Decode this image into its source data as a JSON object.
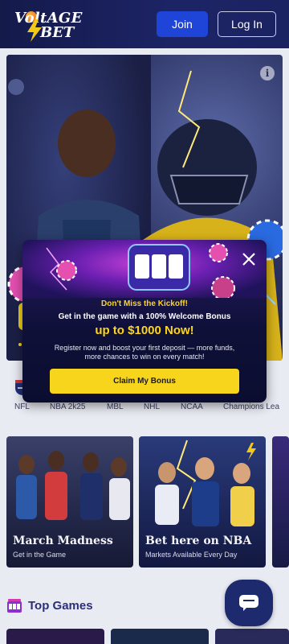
{
  "header": {
    "logo_line1": "VoltAGE",
    "logo_line2": "BET",
    "join_label": "Join",
    "login_label": "Log In"
  },
  "hero": {
    "info_icon": "info-icon"
  },
  "sports": [
    {
      "label": "NFL",
      "icon": "nfl-shield-icon"
    },
    {
      "label": "NBA 2k25"
    },
    {
      "label": "MBL"
    },
    {
      "label": "NHL"
    },
    {
      "label": "NCAA"
    },
    {
      "label": "Champions Lea"
    }
  ],
  "promos": [
    {
      "title": "March Madness",
      "subtitle": "Get in the Game"
    },
    {
      "title": "Bet here on NBA",
      "subtitle": "Markets Available Every Day"
    }
  ],
  "top_games": {
    "title": "Top Games",
    "icon": "slot-machine-icon"
  },
  "chat": {
    "icon": "chat-bubble-icon"
  },
  "modal": {
    "kicker": "Don't Miss the Kickoff!",
    "line": "Get in the game with a 100% Welcome Bonus",
    "amount": "up to $1000 Now!",
    "description": "Register now and boost your first deposit — more funds, more chances to win on every match!",
    "cta_label": "Claim My Bonus",
    "close_icon": "close-icon"
  },
  "colors": {
    "header_bg": "#1d2466",
    "join_bg": "#1f45d8",
    "accent_yellow": "#f7d51c",
    "modal_bg": "#0e1038",
    "page_bg": "#e9ebf3",
    "title_blue": "#2a2f7a"
  }
}
